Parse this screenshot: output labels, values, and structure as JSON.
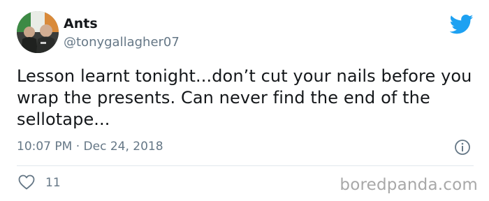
{
  "author": {
    "display_name": "Ants",
    "handle": "@tonygallagher07",
    "avatar_icon": "profile-photo",
    "brand_icon": "twitter-bird-icon"
  },
  "tweet": {
    "text": "Lesson learnt tonight...don’t cut your nails before you wrap the presents. Can never find the end of the sellotape...",
    "timestamp": "10:07 PM · Dec 24, 2018"
  },
  "actions": {
    "like_icon": "heart-icon",
    "like_count": "11",
    "info_icon": "info-icon"
  },
  "watermark": "boredpanda.com",
  "colors": {
    "text_primary": "#14171a",
    "text_secondary": "#657786",
    "twitter_blue": "#1da1f2",
    "divider": "#e1e8ed",
    "watermark": "#a8a8a8"
  }
}
